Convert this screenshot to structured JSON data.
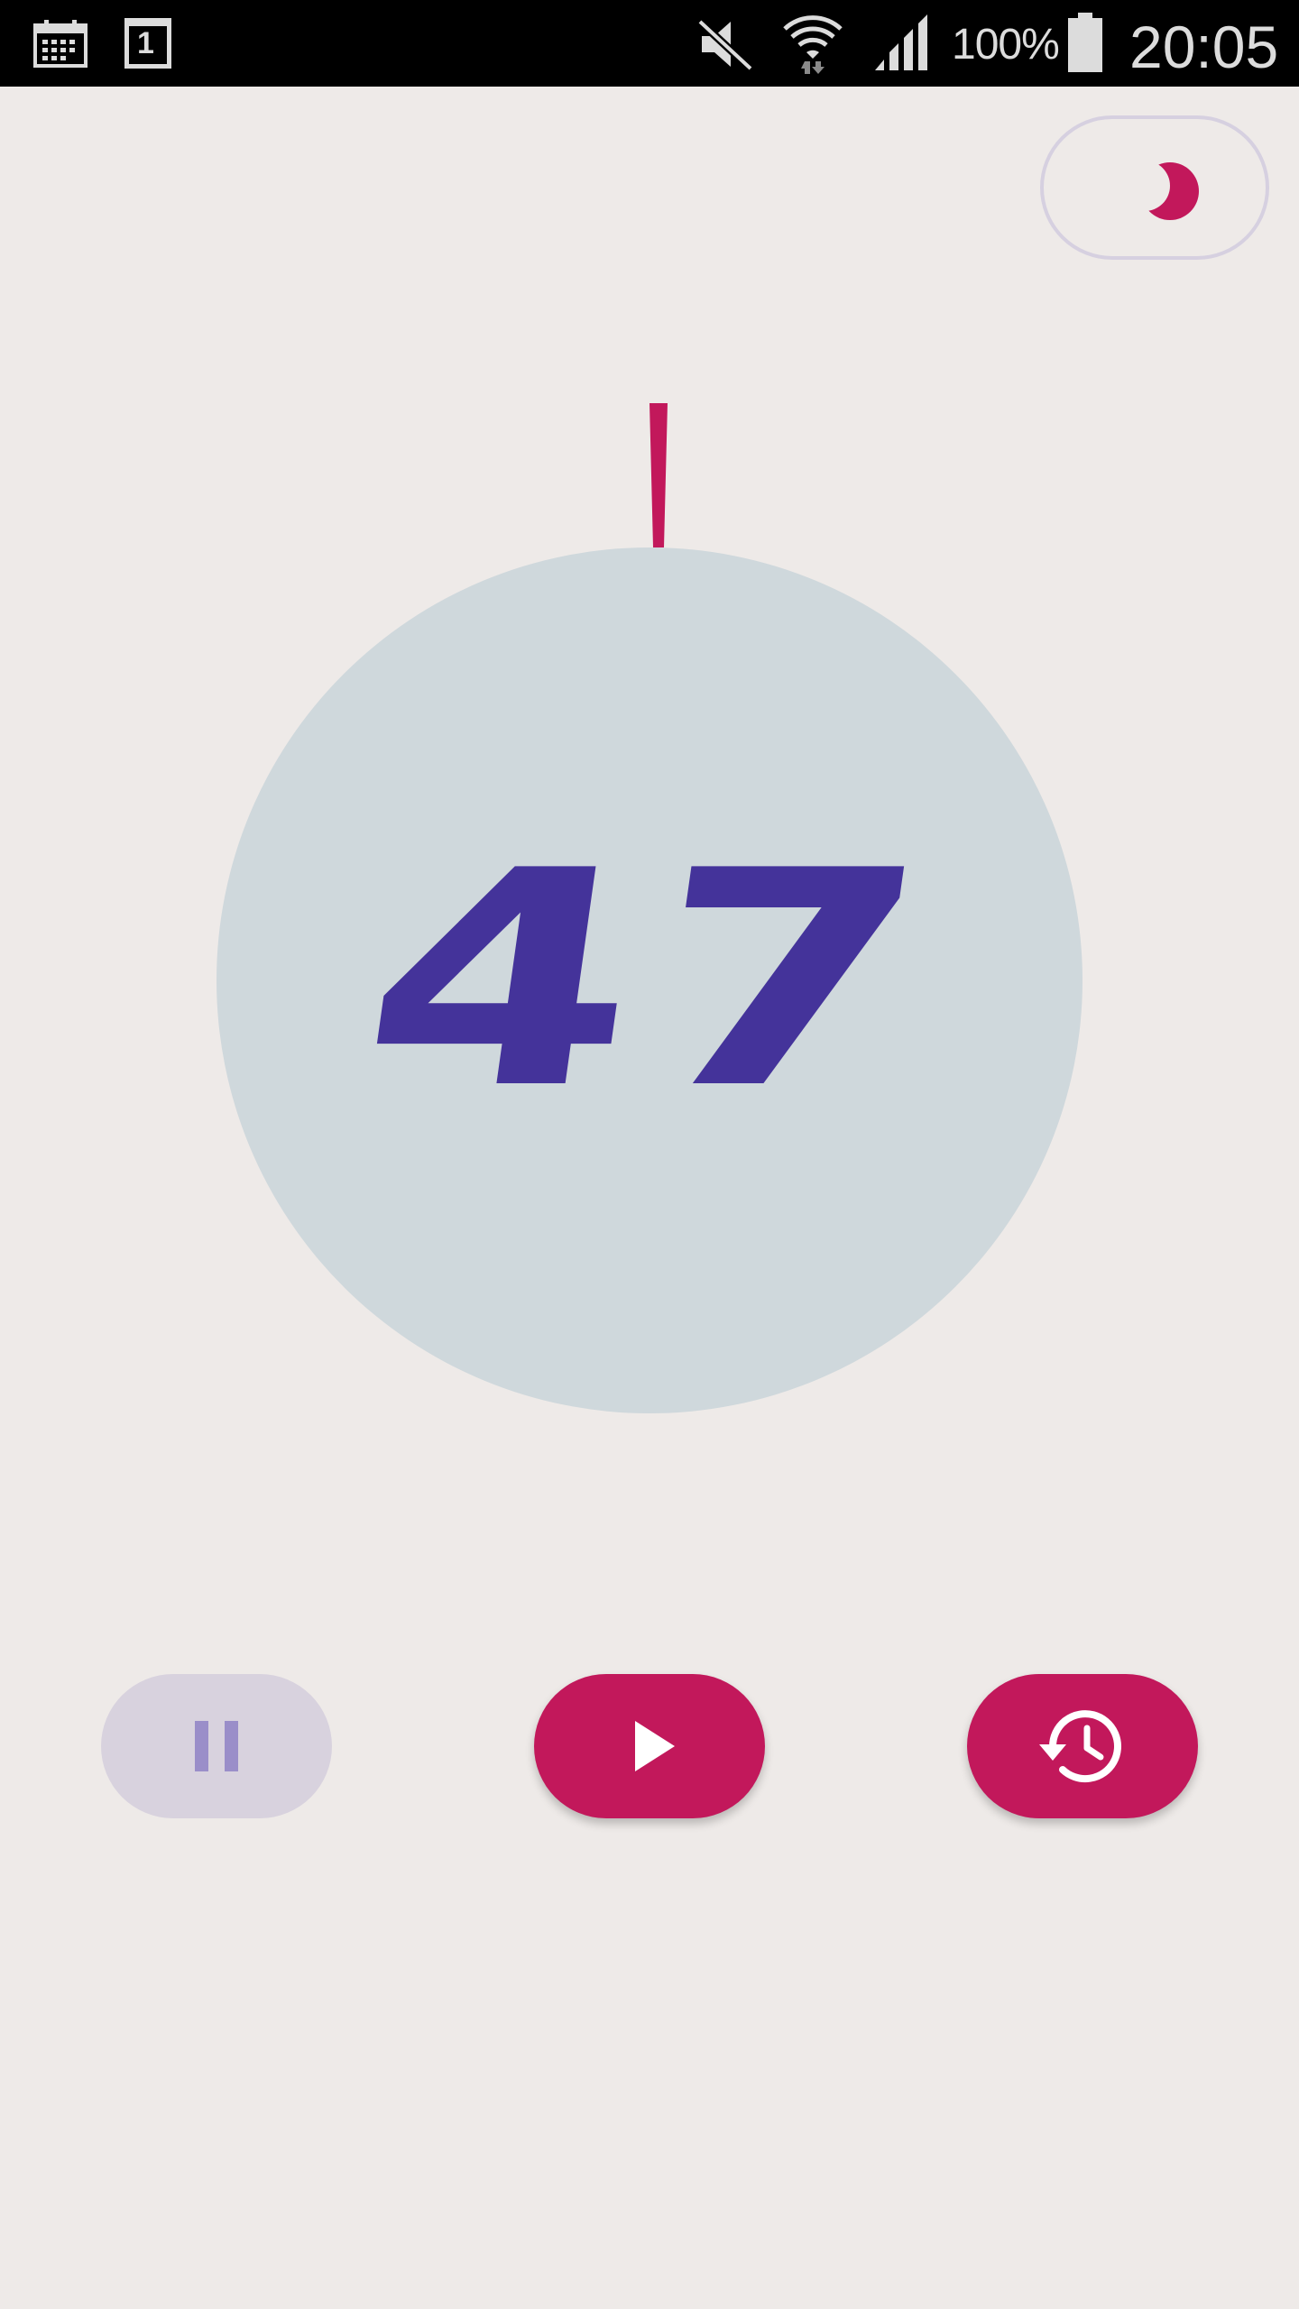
{
  "status_bar": {
    "icons": [
      "calendar-icon",
      "calendar-day-icon",
      "mute-icon",
      "wifi-icon",
      "signal-icon",
      "battery-icon"
    ],
    "calendar_day": "1",
    "battery_percent": "100%",
    "time": "20:05"
  },
  "theme_toggle": {
    "icon": "moon-icon"
  },
  "timer": {
    "value": "47",
    "needle_icon": "timer-needle"
  },
  "controls": {
    "pause": {
      "icon": "pause-icon",
      "enabled": false
    },
    "play": {
      "icon": "play-icon",
      "enabled": true
    },
    "history": {
      "icon": "history-icon",
      "enabled": true
    }
  },
  "colors": {
    "background": "#eeeae8",
    "accent": "#c2185b",
    "dial": "#cfd8dc",
    "number": "#44339a",
    "disabled": "#d8d2de",
    "disabled_icon": "#9a8ec9"
  }
}
